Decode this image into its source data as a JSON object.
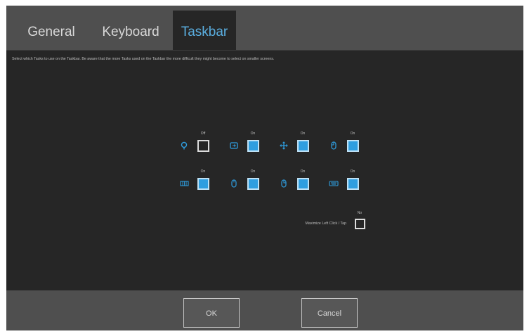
{
  "tabs": [
    {
      "label": "General"
    },
    {
      "label": "Keyboard"
    },
    {
      "label": "Taskbar",
      "active": true
    }
  ],
  "description": "Select which Tasks to use on the Taskbar. Be aware that the more Tasks used on the Taskbar the more difficult they might become to select on smaller screens.",
  "tasks": [
    {
      "icon": "pin-icon",
      "state": "Off",
      "checked": false
    },
    {
      "icon": "window-arrow-icon",
      "state": "On",
      "checked": true
    },
    {
      "icon": "move-arrows-icon",
      "state": "On",
      "checked": true
    },
    {
      "icon": "mouse-left-icon",
      "state": "On",
      "checked": true
    },
    {
      "icon": "keyboard-grid-icon",
      "state": "On",
      "checked": true
    },
    {
      "icon": "mouse-icon",
      "state": "On",
      "checked": true
    },
    {
      "icon": "mouse-right-icon",
      "state": "On",
      "checked": true
    },
    {
      "icon": "keyboard-icon",
      "state": "On",
      "checked": true
    }
  ],
  "maximize": {
    "label": "Maximize Left Click / Tap",
    "state": "No",
    "checked": false
  },
  "buttons": {
    "ok": "OK",
    "cancel": "Cancel"
  },
  "colors": {
    "accent": "#2f9ee0",
    "panel": "#262626",
    "chrome": "#4f4f4f"
  }
}
